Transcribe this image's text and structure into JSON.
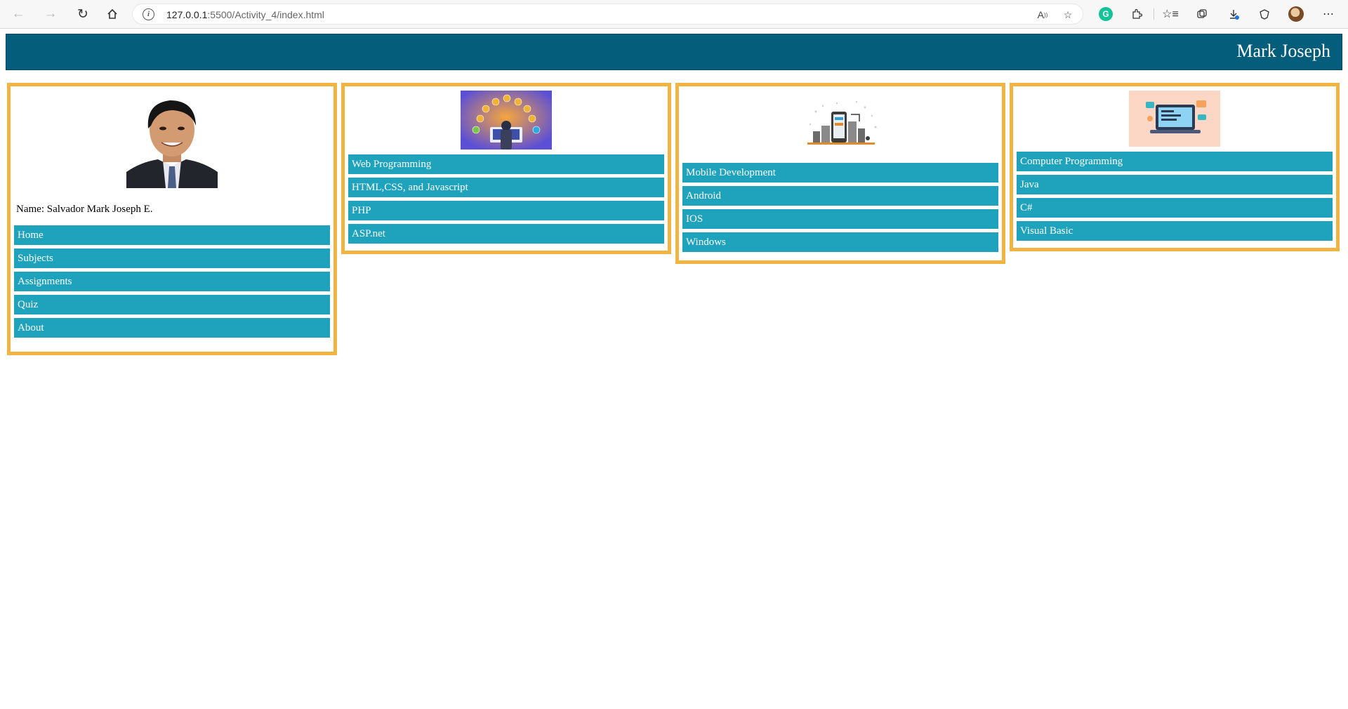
{
  "browser": {
    "url_host": "127.0.0.1",
    "url_path": ":5500/Activity_4/index.html"
  },
  "header": {
    "brand": "Mark Joseph"
  },
  "profile": {
    "name_label": "Name: Salvador Mark Joseph E.",
    "nav": [
      {
        "label": "Home"
      },
      {
        "label": "Subjects"
      },
      {
        "label": "Assignments"
      },
      {
        "label": "Quiz"
      },
      {
        "label": "About"
      }
    ]
  },
  "web": {
    "items": [
      {
        "label": "Web Programming"
      },
      {
        "label": "HTML,CSS, and Javascript"
      },
      {
        "label": "PHP"
      },
      {
        "label": "ASP.net"
      }
    ]
  },
  "mobile": {
    "items": [
      {
        "label": "Mobile Development"
      },
      {
        "label": "Android"
      },
      {
        "label": "IOS"
      },
      {
        "label": "Windows"
      }
    ]
  },
  "programming": {
    "items": [
      {
        "label": "Computer Programming"
      },
      {
        "label": "Java"
      },
      {
        "label": "C#"
      },
      {
        "label": "Visual Basic"
      }
    ]
  },
  "colors": {
    "header_bg": "#035d7b",
    "card_border": "#f0b442",
    "menu_bg": "#1fa3bd"
  },
  "icons": [
    "back-icon",
    "forward-icon",
    "refresh-icon",
    "home-icon",
    "info-icon",
    "read-aloud-icon",
    "favorite-add-icon",
    "grammarly-icon",
    "extensions-icon",
    "favorites-icon",
    "collections-icon",
    "downloads-icon",
    "browser-essentials-icon",
    "profile-avatar-icon",
    "more-icon"
  ]
}
